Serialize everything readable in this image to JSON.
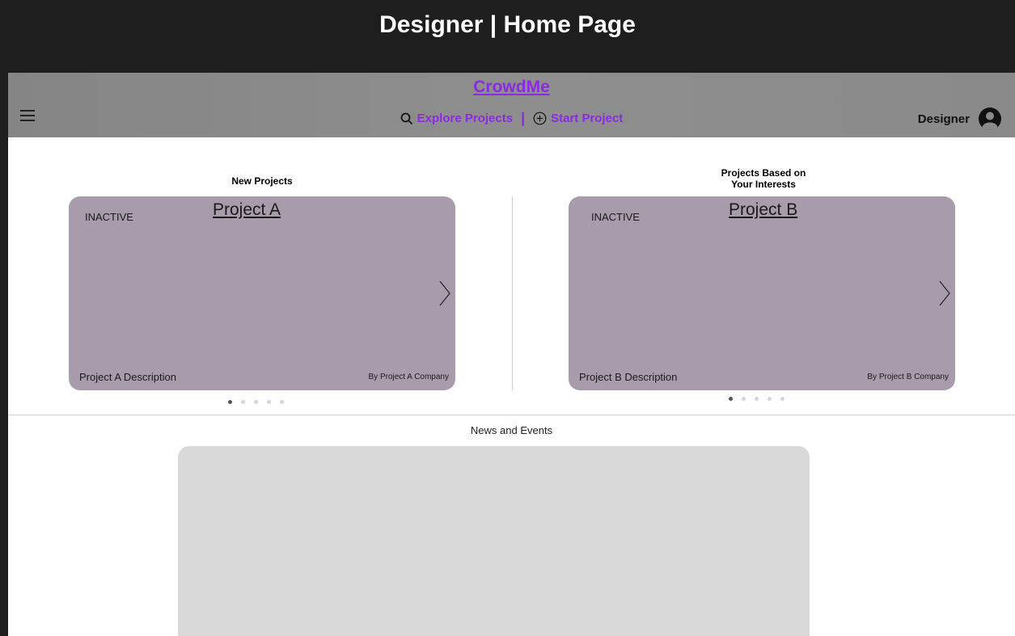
{
  "frame": {
    "title": "Designer | Home Page"
  },
  "navbar": {
    "brand": "CrowdMe",
    "explore_label": "Explore Projects",
    "separator": "|",
    "start_label": "Start Project",
    "user_label": "Designer"
  },
  "sections": {
    "new_projects": {
      "title": "New Projects",
      "card": {
        "status": "INACTIVE",
        "title": "Project A",
        "description": "Project A Description",
        "company": "By Project A Company"
      },
      "carousel_total": 5,
      "carousel_active": 1
    },
    "interest_projects": {
      "title": "Projects Based on Your Interests",
      "card": {
        "status": "INACTIVE",
        "title": "Project B",
        "description": "Project B Description",
        "company": "By Project B Company"
      },
      "carousel_total": 5,
      "carousel_active": 1
    }
  },
  "news": {
    "title": "News and Events"
  },
  "colors": {
    "accent": "#8a2be2",
    "card": "#a89cac",
    "navbar": "#8a8a8a",
    "news_panel": "#d9d9d9"
  }
}
